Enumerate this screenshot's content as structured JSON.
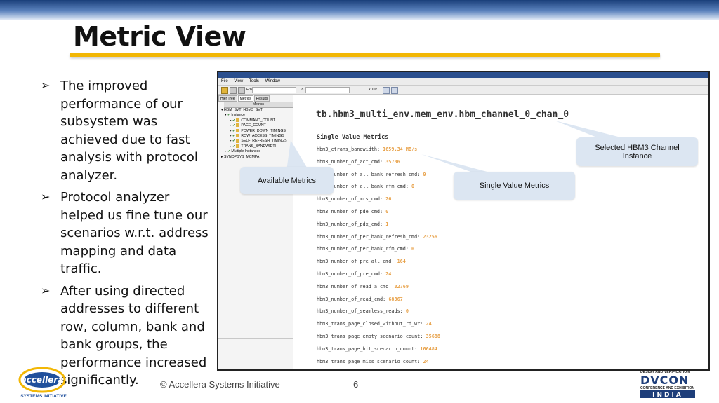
{
  "slide": {
    "title": "Metric View",
    "bullets": [
      "The improved performance of our subsystem was achieved due to fast analysis with protocol analyzer.",
      "Protocol analyzer helped us fine tune our scenarios w.r.t. address mapping and data traffic.",
      "After using directed addresses to different row, column, bank and bank groups, the performance increased significantly."
    ],
    "footer": {
      "copyright": "© Accellera Systems Initiative",
      "page": "6"
    },
    "logos": {
      "accellera_tagline": "SYSTEMS INITIATIVE",
      "dvcon_top": "DESIGN AND VERIFICATION",
      "dvcon_bottom": "CONFERENCE AND EXHIBITION",
      "dvcon_region": "INDIA"
    }
  },
  "app": {
    "menu": [
      "File",
      "View",
      "Tools",
      "Window"
    ],
    "toolbar": {
      "from_label": "From",
      "to_label": "To",
      "zoom": "x 10k"
    },
    "tabs": [
      "Hier Tree",
      "Metrics",
      "Results"
    ],
    "panel_header": "Metrics",
    "tree": [
      "HBM_SVT_HBM3_SVT",
      "Instance",
      "COMMAND_COUNT",
      "PAGE_COUNT",
      "POWER_DOWN_TIMINGS",
      "ROW_ACCESS_TIMINGS",
      "SELF_REFRESH_TIMINGS",
      "TRANS_BANDWIDTH",
      "Multiple Instances",
      "SYNOPSYS_MCMPA"
    ],
    "instance_title": "tb.hbm3_multi_env.mem_env.hbm_channel_0_chan_0",
    "section_title": "Single Value Metrics",
    "metrics": [
      {
        "name": "hbm3_ctrans_bandwidth",
        "value": "1659.34 MB/s"
      },
      {
        "name": "hbm3_number_of_act_cmd",
        "value": "35736"
      },
      {
        "name": "hbm3_number_of_all_bank_refresh_cmd",
        "value": "0"
      },
      {
        "name": "hbm3_number_of_all_bank_rfm_cmd",
        "value": "0"
      },
      {
        "name": "hbm3_number_of_mrs_cmd",
        "value": "26"
      },
      {
        "name": "hbm3_number_of_pde_cmd",
        "value": "0"
      },
      {
        "name": "hbm3_number_of_pdx_cmd",
        "value": "1"
      },
      {
        "name": "hbm3_number_of_per_bank_refresh_cmd",
        "value": "23256"
      },
      {
        "name": "hbm3_number_of_per_bank_rfm_cmd",
        "value": "0"
      },
      {
        "name": "hbm3_number_of_pre_all_cmd",
        "value": "164"
      },
      {
        "name": "hbm3_number_of_pre_cmd",
        "value": "24"
      },
      {
        "name": "hbm3_number_of_read_a_cmd",
        "value": "32769"
      },
      {
        "name": "hbm3_number_of_read_cmd",
        "value": "68367"
      },
      {
        "name": "hbm3_number_of_seamless_reads",
        "value": "0"
      },
      {
        "name": "hbm3_trans_page_closed_without_rd_wr",
        "value": "24"
      },
      {
        "name": "hbm3_trans_page_empty_scenario_count",
        "value": "35688"
      },
      {
        "name": "hbm3_trans_page_hit_scenario_count",
        "value": "166484"
      },
      {
        "name": "hbm3_trans_page_miss_scenario_count",
        "value": "24"
      }
    ]
  },
  "callouts": {
    "available_metrics": "Available Metrics",
    "single_value_metrics": "Single Value Metrics",
    "selected_instance": "Selected HBM3 Channel Instance"
  },
  "colors": {
    "accent_rule": "#f2b705",
    "metric_value": "#e8a24a",
    "callout_bg": "#dce6f2"
  }
}
